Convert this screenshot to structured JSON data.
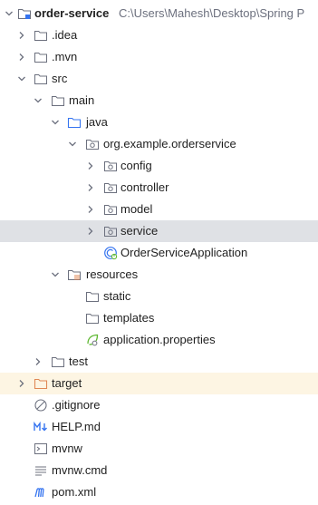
{
  "project": {
    "name": "order-service",
    "path": "C:\\Users\\Mahesh\\Desktop\\Spring P"
  },
  "tree": {
    "idea": ".idea",
    "mvn": ".mvn",
    "src": "src",
    "main": "main",
    "java": "java",
    "package": "org.example.orderservice",
    "config": "config",
    "controller": "controller",
    "model": "model",
    "service": "service",
    "app_class": "OrderServiceApplication",
    "resources": "resources",
    "static": "static",
    "templates": "templates",
    "app_properties": "application.properties",
    "test": "test",
    "target": "target",
    "gitignore": ".gitignore",
    "help": "HELP.md",
    "mvnw": "mvnw",
    "mvnw_cmd": "mvnw.cmd",
    "pom": "pom.xml"
  },
  "icons": {
    "project_root": "module-folder-icon",
    "folder": "folder-icon",
    "source_root": "source-folder-icon",
    "package": "package-icon",
    "resources_root": "resources-folder-icon",
    "excluded_folder": "excluded-folder-icon",
    "spring_boot_class": "spring-boot-class-icon",
    "properties": "properties-file-icon",
    "gitignore": "ignore-file-icon",
    "markdown": "markdown-file-icon",
    "shell": "shell-script-icon",
    "text": "text-file-icon",
    "maven": "maven-file-icon"
  },
  "colors": {
    "selected_row": "#dfe1e5",
    "excluded_row": "#fdf5e3",
    "folder_stroke": "#6c707e",
    "source_folder": "#3574f0",
    "excluded_folder": "#e08855",
    "spring_green": "#5fb832",
    "maven_blue": "#3574f0",
    "path_gray": "#6c707e"
  }
}
